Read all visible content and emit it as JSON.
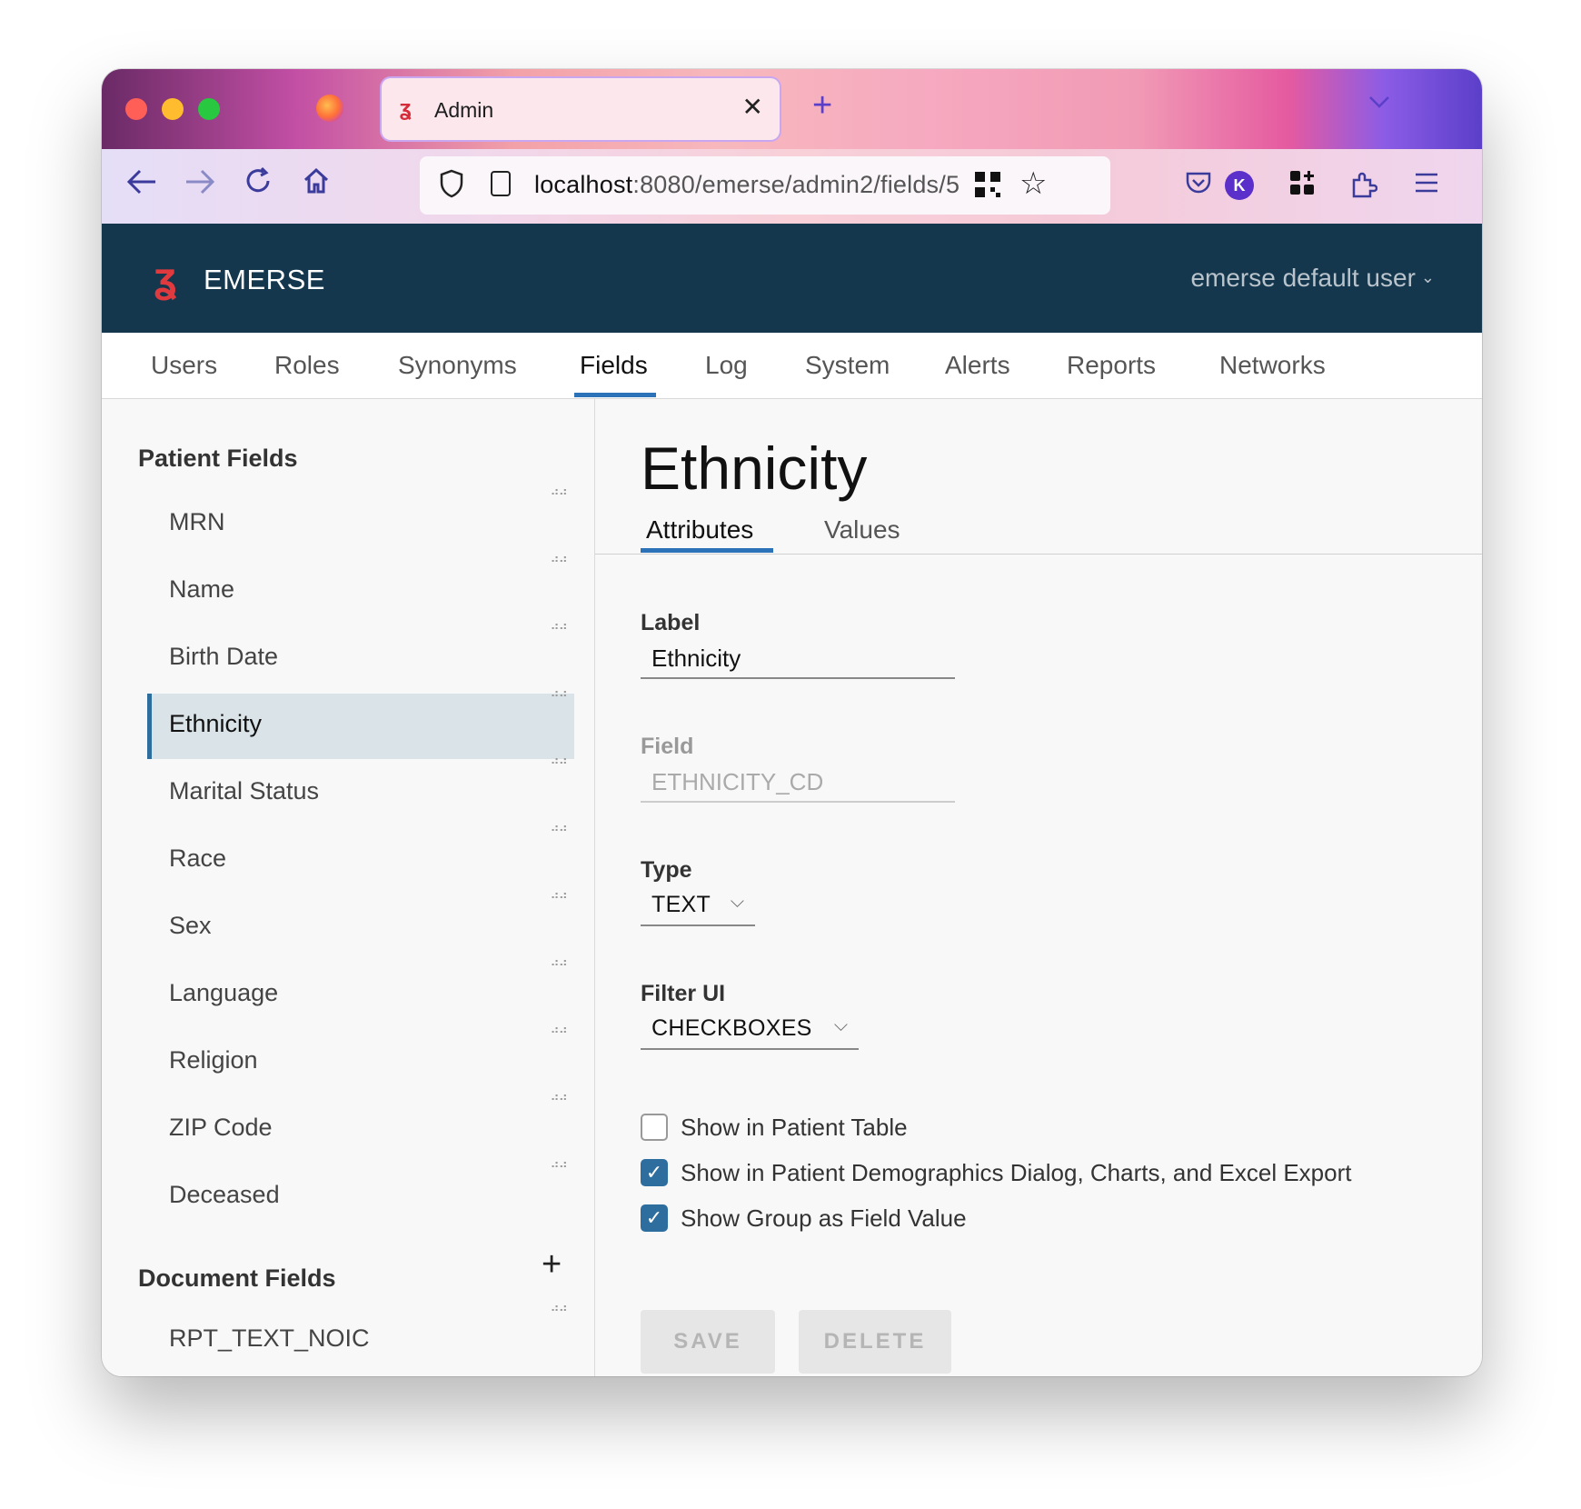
{
  "browser": {
    "tab_title": "Admin",
    "tab_close": "✕",
    "new_tab": "+",
    "tab_list": "⌄",
    "url_host": "localhost",
    "url_rest": ":8080/emerse/admin2/fields/5",
    "account_initial": "K"
  },
  "app": {
    "logo_text": "EMERSE",
    "user_menu": "emerse default user",
    "brand_color": "#14374e",
    "accent_color": "#2b72b8"
  },
  "top_tabs": [
    {
      "label": "Users"
    },
    {
      "label": "Roles"
    },
    {
      "label": "Synonyms"
    },
    {
      "label": "Fields",
      "active": true
    },
    {
      "label": "Log"
    },
    {
      "label": "System"
    },
    {
      "label": "Alerts"
    },
    {
      "label": "Reports"
    },
    {
      "label": "Networks"
    }
  ],
  "sidebar": {
    "patient_fields_title": "Patient Fields",
    "patient_fields": [
      {
        "label": "MRN"
      },
      {
        "label": "Name"
      },
      {
        "label": "Birth Date"
      },
      {
        "label": "Ethnicity",
        "selected": true
      },
      {
        "label": "Marital Status"
      },
      {
        "label": "Race"
      },
      {
        "label": "Sex"
      },
      {
        "label": "Language"
      },
      {
        "label": "Religion"
      },
      {
        "label": "ZIP Code"
      },
      {
        "label": "Deceased"
      }
    ],
    "document_fields_title": "Document Fields",
    "document_fields": [
      {
        "label": "RPT_TEXT_NOIC"
      }
    ],
    "add_icon": "+"
  },
  "main": {
    "title": "Ethnicity",
    "tabs": [
      {
        "label": "Attributes",
        "active": true
      },
      {
        "label": "Values"
      }
    ],
    "form": {
      "label_caption": "Label",
      "label_value": "Ethnicity",
      "field_caption": "Field",
      "field_value": "ETHNICITY_CD",
      "type_caption": "Type",
      "type_value": "TEXT",
      "filter_caption": "Filter UI",
      "filter_value": "CHECKBOXES",
      "checkboxes": [
        {
          "label": "Show in Patient Table",
          "checked": false
        },
        {
          "label": "Show in Patient Demographics Dialog, Charts, and Excel Export",
          "checked": true
        },
        {
          "label": "Show Group as Field Value",
          "checked": true
        }
      ],
      "save_label": "SAVE",
      "delete_label": "DELETE"
    }
  }
}
